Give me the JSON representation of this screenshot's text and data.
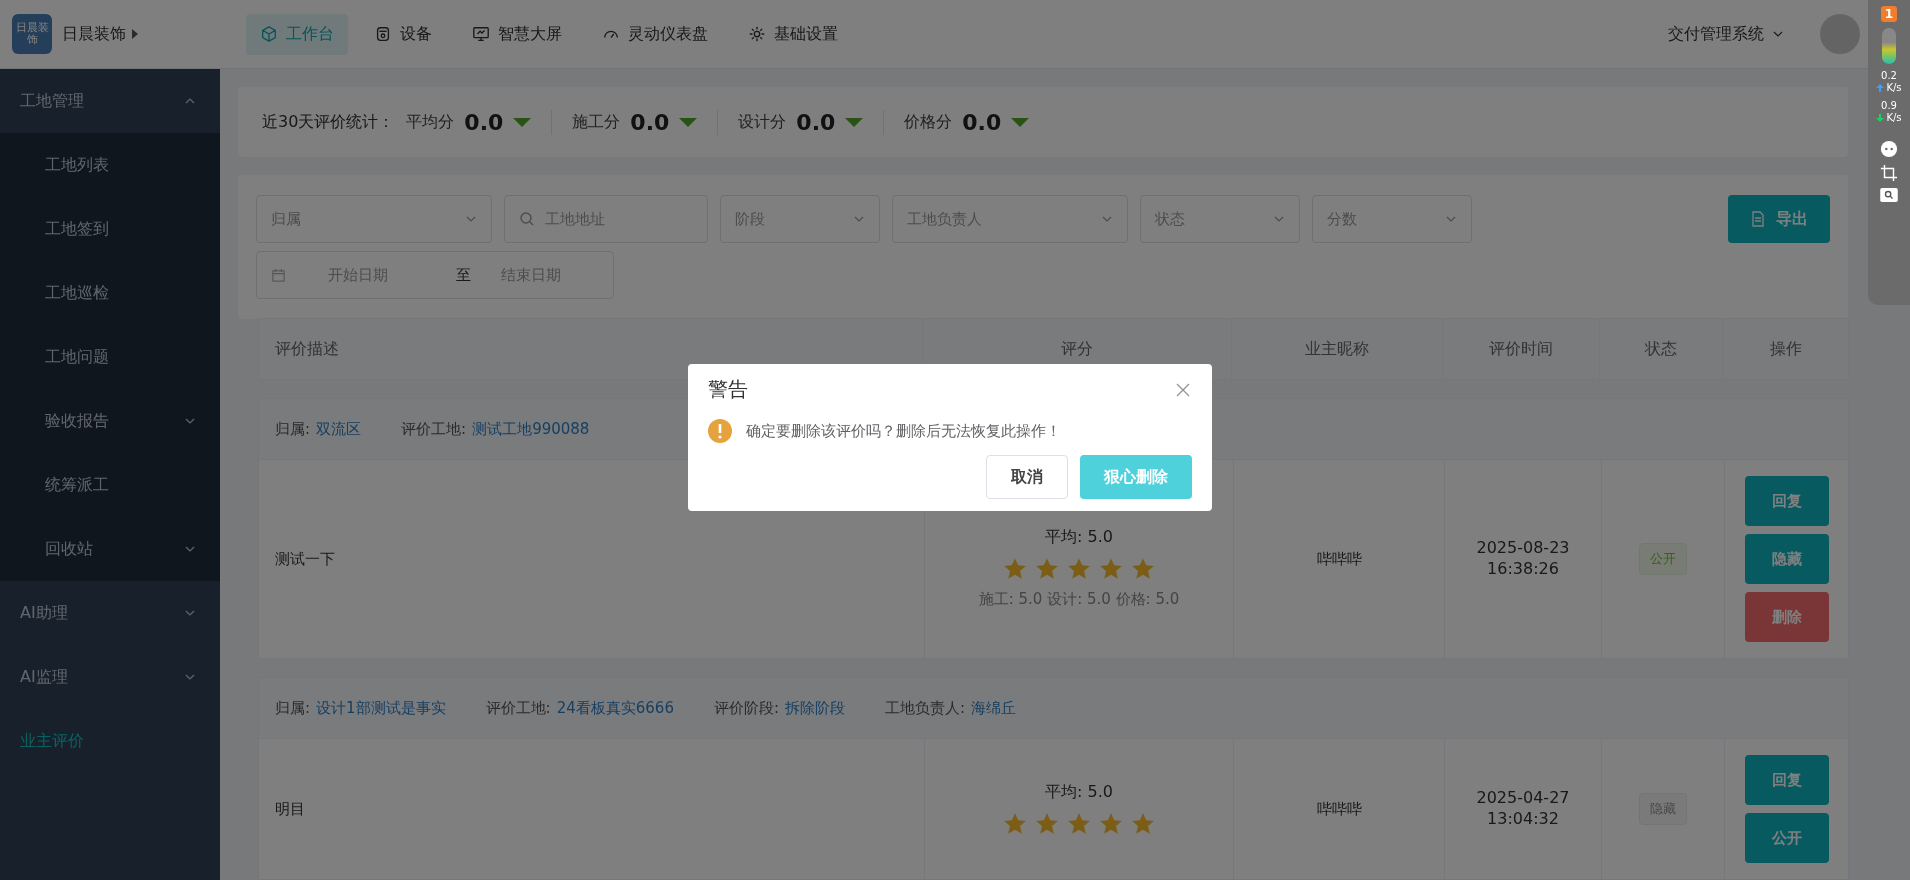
{
  "brand": {
    "logo_text": "日晨装饰",
    "name": "日晨装饰"
  },
  "nav": {
    "tabs": [
      {
        "label": "工作台",
        "selected": true
      },
      {
        "label": "设备",
        "selected": false
      },
      {
        "label": "智慧大屏",
        "selected": false
      },
      {
        "label": "灵动仪表盘",
        "selected": false
      },
      {
        "label": "基础设置",
        "selected": false
      }
    ],
    "system": "交付管理系统"
  },
  "sidebar": {
    "items": [
      {
        "label": "工地管理",
        "expanded": true,
        "selected": false,
        "children": [
          {
            "label": "工地列表",
            "selected": false
          },
          {
            "label": "工地签到",
            "selected": false
          },
          {
            "label": "工地巡检",
            "selected": false
          },
          {
            "label": "工地问题",
            "selected": false
          },
          {
            "label": "验收报告",
            "selected": false,
            "expanded": false
          },
          {
            "label": "统筹派工",
            "selected": false
          },
          {
            "label": "回收站",
            "selected": false,
            "expanded": false
          }
        ]
      },
      {
        "label": "AI助理",
        "expanded": false,
        "selected": false
      },
      {
        "label": "AI监理",
        "expanded": false,
        "selected": false
      },
      {
        "label": "业主评价",
        "selected": true
      }
    ]
  },
  "stats": {
    "title": "近30天评价统计：",
    "items": [
      {
        "label": "平均分",
        "value": "0.0"
      },
      {
        "label": "施工分",
        "value": "0.0"
      },
      {
        "label": "设计分",
        "value": "0.0"
      },
      {
        "label": "价格分",
        "value": "0.0"
      }
    ]
  },
  "filters": {
    "fields": [
      {
        "kind": "select",
        "placeholder": "归属"
      },
      {
        "kind": "search",
        "placeholder": "工地地址"
      },
      {
        "kind": "select",
        "placeholder": "阶段"
      },
      {
        "kind": "select",
        "placeholder": "工地负责人"
      },
      {
        "kind": "select",
        "placeholder": "状态"
      },
      {
        "kind": "select",
        "placeholder": "分数"
      }
    ],
    "date_range": {
      "start_placeholder": "开始日期",
      "separator": "至",
      "end_placeholder": "结束日期"
    },
    "export_button": "导出"
  },
  "table": {
    "columns": [
      "评价描述",
      "评分",
      "业主昵称",
      "评价时间",
      "状态",
      "操作"
    ],
    "rows": [
      {
        "meta": [
          {
            "label": "归属:",
            "value": "双流区"
          },
          {
            "label": "评价工地:",
            "value": "测试工地990088"
          }
        ],
        "description": "测试一下",
        "average": "平均: 5.0",
        "stars": 5,
        "sub_scores": "施工: 5.0 设计: 5.0 价格: 5.0",
        "nickname": "哔哔哔",
        "date": "2025-08-23",
        "time": "16:38:26",
        "status": {
          "label": "公开",
          "kind": "public"
        },
        "actions": [
          {
            "label": "回复",
            "kind": "primary"
          },
          {
            "label": "隐藏",
            "kind": "primary"
          },
          {
            "label": "删除",
            "kind": "danger"
          }
        ]
      },
      {
        "meta": [
          {
            "label": "归属:",
            "value": "设计1部测试是事实"
          },
          {
            "label": "评价工地:",
            "value": "24看板真实6666"
          },
          {
            "label": "评价阶段:",
            "value": "拆除阶段"
          },
          {
            "label": "工地负责人:",
            "value": "海绵丘"
          }
        ],
        "description": "明目",
        "average": "平均: 5.0",
        "stars": 5,
        "nickname": "哔哔哔",
        "date": "2025-04-27",
        "time": "13:04:32",
        "status": {
          "label": "隐藏",
          "kind": "hidden"
        },
        "actions": [
          {
            "label": "回复",
            "kind": "primary"
          },
          {
            "label": "公开",
            "kind": "primary"
          }
        ]
      }
    ]
  },
  "dialog": {
    "title": "警告",
    "message": "确定要删除该评价吗？删除后无法恢复此操作！",
    "cancel": "取消",
    "confirm": "狠心删除"
  },
  "widget": {
    "badge": "1",
    "upload": "0.2",
    "upload_unit": "K/s",
    "download": "0.9",
    "download_unit": "K/s"
  }
}
